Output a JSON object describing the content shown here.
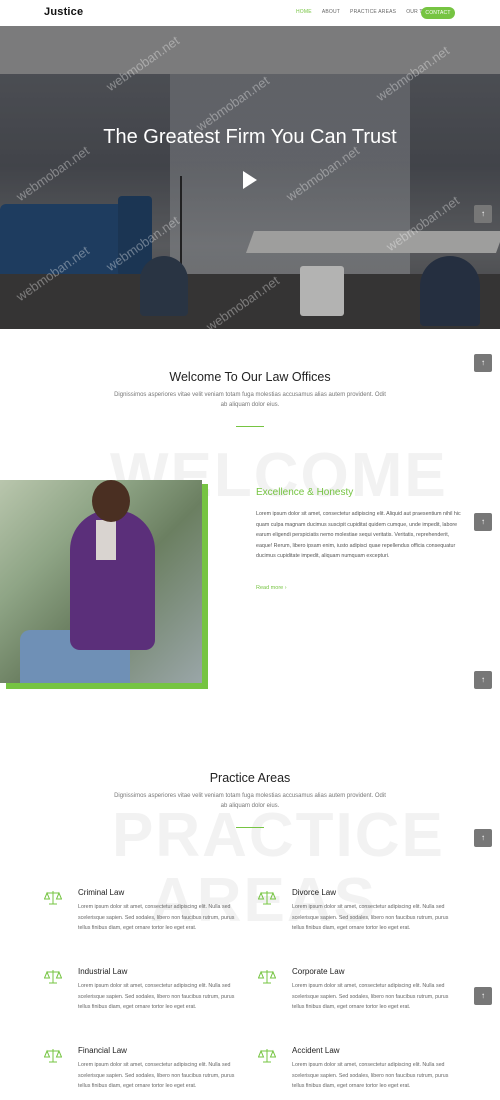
{
  "brand": {
    "name_bold": "Jus",
    "name_rest": "tice"
  },
  "nav": {
    "items": [
      {
        "label": "HOME",
        "active": true
      },
      {
        "label": "ABOUT",
        "active": false
      },
      {
        "label": "PRACTICE AREAS",
        "active": false
      },
      {
        "label": "OUR TEAM",
        "active": false
      }
    ],
    "contact_label": "CONTACT"
  },
  "hero": {
    "title": "The Greatest Firm You Can Trust"
  },
  "welcome": {
    "title": "Welcome To Our Law Offices",
    "subtitle": "Dignissimos asperiores vitae velit veniam totam fuga molestias accusamus alias autem provident. Odit ab aliquam dolor eius.",
    "background_word": "WELCOME"
  },
  "about": {
    "heading": "Excellence & Honesty",
    "text": "Lorem ipsum dolor sit amet, consectetur adipiscing elit. Aliquid aut praesentium nihil hic quam culpa magnam ducimus suscipit cupiditat quidem cumque, unde impedit, labore earum eligendi perspiciatis nemo molestiae sequi veritatis. Veritatis, reprehenderit, eaque! Rerum, libero ipsam enim, iusto adipisci quae repellendus officia consequatur ducimus cupiditate impedit, aliquam numquam excepturi.",
    "read_more": "Read more ›"
  },
  "practice": {
    "title": "Practice Areas",
    "subtitle": "Dignissimos asperiores vitae velit veniam totam fuga molestias accusamus alias autem provident. Odit ab aliquam dolor eius.",
    "background_word_1": "PRACTICE",
    "background_word_2": "AREAS",
    "cards": [
      {
        "title": "Criminal Law",
        "text": "Lorem ipsum dolor sit amet, consectetur adipiscing elit. Nulla sed scelerisque sapien. Sed sodales, libero non faucibus rutrum, purus tellus finibus diam, eget ornare tortor leo eget erat.",
        "icon": "scales-icon"
      },
      {
        "title": "Divorce Law",
        "text": "Lorem ipsum dolor sit amet, consectetur adipiscing elit. Nulla sed scelerisque sapien. Sed sodales, libero non faucibus rutrum, purus tellus finibus diam, eget ornare tortor leo eget erat.",
        "icon": "scales-icon"
      },
      {
        "title": "Industrial Law",
        "text": "Lorem ipsum dolor sit amet, consectetur adipiscing elit. Nulla sed scelerisque sapien. Sed sodales, libero non faucibus rutrum, purus tellus finibus diam, eget ornare tortor leo eget erat.",
        "icon": "scales-icon"
      },
      {
        "title": "Corporate Law",
        "text": "Lorem ipsum dolor sit amet, consectetur adipiscing elit. Nulla sed scelerisque sapien. Sed sodales, libero non faucibus rutrum, purus tellus finibus diam, eget ornare tortor leo eget erat.",
        "icon": "scales-icon"
      },
      {
        "title": "Financial Law",
        "text": "Lorem ipsum dolor sit amet, consectetur adipiscing elit. Nulla sed scelerisque sapien. Sed sodales, libero non faucibus rutrum, purus tellus finibus diam, eget ornare tortor leo eget erat.",
        "icon": "scales-icon"
      },
      {
        "title": "Accident Law",
        "text": "Lorem ipsum dolor sit amet, consectetur adipiscing elit. Nulla sed scelerisque sapien. Sed sodales, libero non faucibus rutrum, purus tellus finibus diam, eget ornare tortor leo eget erat.",
        "icon": "scales-icon"
      }
    ]
  },
  "scroll_top_label": "↑",
  "watermark": "webmoban.net",
  "colors": {
    "accent": "#76c442",
    "text": "#222222",
    "muted": "#777777"
  }
}
